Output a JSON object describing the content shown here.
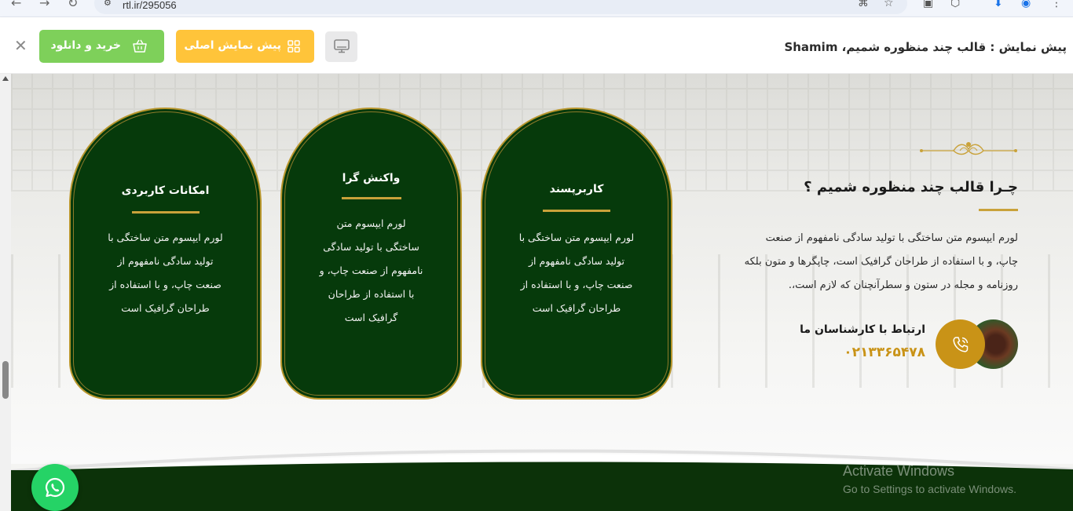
{
  "browser": {
    "url": "rtl.ir/295056"
  },
  "header": {
    "title": "پیش نمایش : قالب چند منظوره شمیم، Shamim",
    "preview_label": "پیش نمایش اصلی",
    "buy_label": "خرید و دانلود"
  },
  "cards": [
    {
      "title": "کاربرپسند",
      "text": [
        "لورم ایپسوم متن ساختگی با",
        "تولید سادگی نامفهوم از",
        "صنعت چاپ، و با استفاده از",
        "طراحان گرافیک است"
      ]
    },
    {
      "title": "واکنش گرا",
      "text": [
        "لورم ایپسوم متن",
        "ساختگی با تولید سادگی",
        "نامفهوم از صنعت چاپ، و",
        "با استفاده از طراحان",
        "گرافیک است"
      ]
    },
    {
      "title": "امکانات کاربردی",
      "text": [
        "لورم ایپسوم متن ساختگی با",
        "تولید سادگی نامفهوم از",
        "صنعت چاپ، و با استفاده از",
        "طراحان گرافیک است"
      ]
    }
  ],
  "why": {
    "title": "چـرا قالب چند منظوره شمیم ؟",
    "lines": [
      "لورم ایپسوم متن ساختگی با تولید سادگی نامفهوم از صنعت",
      "چاپ، و با استفاده از طراحان گرافیک است، چاپگرها و متون بلکه",
      "روزنامه و مجله در ستون و سطرآنچنان که لازم است،."
    ]
  },
  "contact": {
    "label": "ارتباط با کارشناسان ما",
    "phone": "۰۲۱۳۳۶۵۴۷۸"
  },
  "watermark": {
    "line1": "Activate Windows",
    "line2": "Go to Settings to activate Windows."
  },
  "colors": {
    "card_bg": "#063a0b",
    "gold": "#c9a23a",
    "preview_button": "#ffc43a",
    "buy_button": "#7ed05a",
    "footer": "#0c3209",
    "whatsapp": "#25d366"
  }
}
